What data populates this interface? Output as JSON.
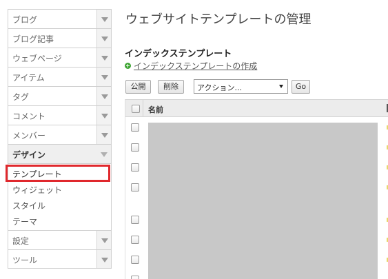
{
  "sidebar": {
    "items": [
      {
        "label": "ブログ"
      },
      {
        "label": "ブログ記事"
      },
      {
        "label": "ウェブページ"
      },
      {
        "label": "アイテム"
      },
      {
        "label": "タグ"
      },
      {
        "label": "コメント"
      },
      {
        "label": "メンバー"
      },
      {
        "label": "デザイン"
      },
      {
        "label": "設定"
      },
      {
        "label": "ツール"
      }
    ],
    "design_sub": [
      {
        "label": "テンプレート"
      },
      {
        "label": "ウィジェット"
      },
      {
        "label": "スタイル"
      },
      {
        "label": "テーマ"
      }
    ]
  },
  "main": {
    "title": "ウェブサイトテンプレートの管理",
    "section_title": "インデックステンプレート",
    "create_link": "インデックステンプレートの作成",
    "publish_button": "公開",
    "delete_button": "削除",
    "action_select": "アクション...",
    "go_button": "Go",
    "table": {
      "column_name": "名前"
    }
  },
  "colors": {
    "highlight": "#e0282d",
    "add_icon": "#3fa534"
  }
}
